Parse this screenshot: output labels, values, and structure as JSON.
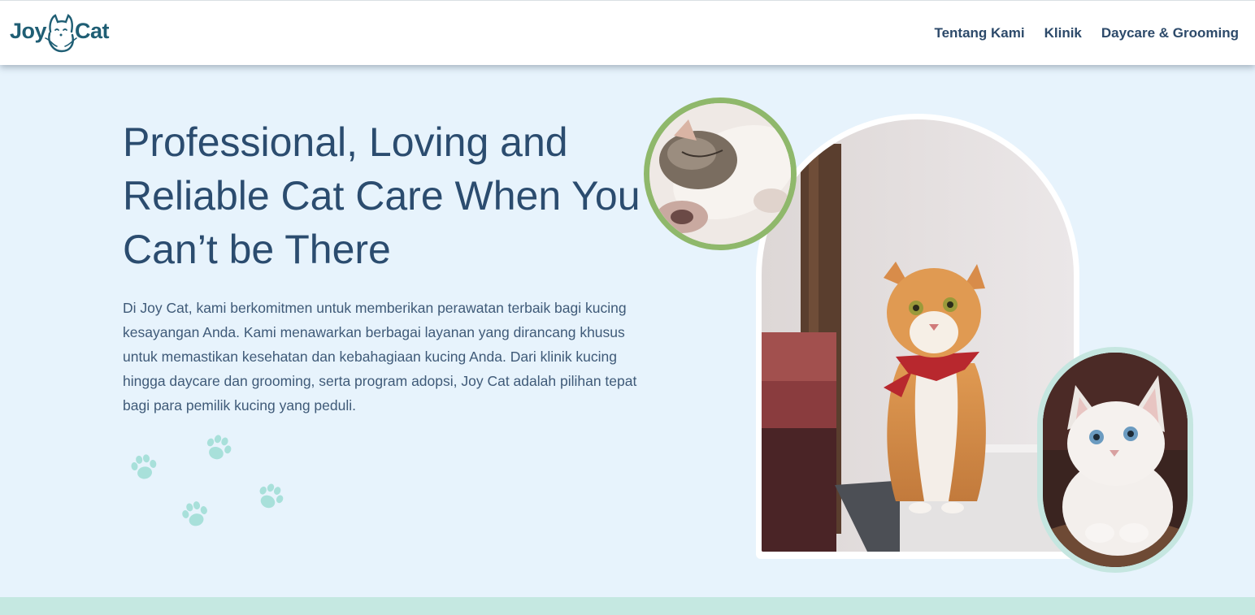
{
  "brand": {
    "word1": "Joy",
    "word2": "Cat"
  },
  "nav": {
    "items": [
      {
        "label": "Tentang Kami"
      },
      {
        "label": "Klinik"
      },
      {
        "label": "Daycare & Grooming"
      }
    ]
  },
  "hero": {
    "title": "Professional, Loving and Reliable Cat Care When You Can’t be There",
    "description": "Di Joy Cat, kami berkomitmen untuk memberikan perawatan terbaik bagi kucing kesayangan Anda. Kami menawarkan berbagai layanan yang dirancang khusus untuk memastikan kesehatan dan kebahagiaan kucing Anda. Dari klinik kucing hingga daycare dan grooming, serta program adopsi, Joy Cat adalah pilihan tepat bagi para pemilik kucing yang peduli."
  },
  "icons": {
    "logo": "cat-logo-icon",
    "decoration": "paw-print-icon"
  },
  "colors": {
    "background": "#e7f3fc",
    "heading": "#2b4c6f",
    "brand": "#1f5e74",
    "green_ring": "#8fb86b",
    "mint_ring": "#c5e6e0",
    "paw": "#a8e0da"
  }
}
